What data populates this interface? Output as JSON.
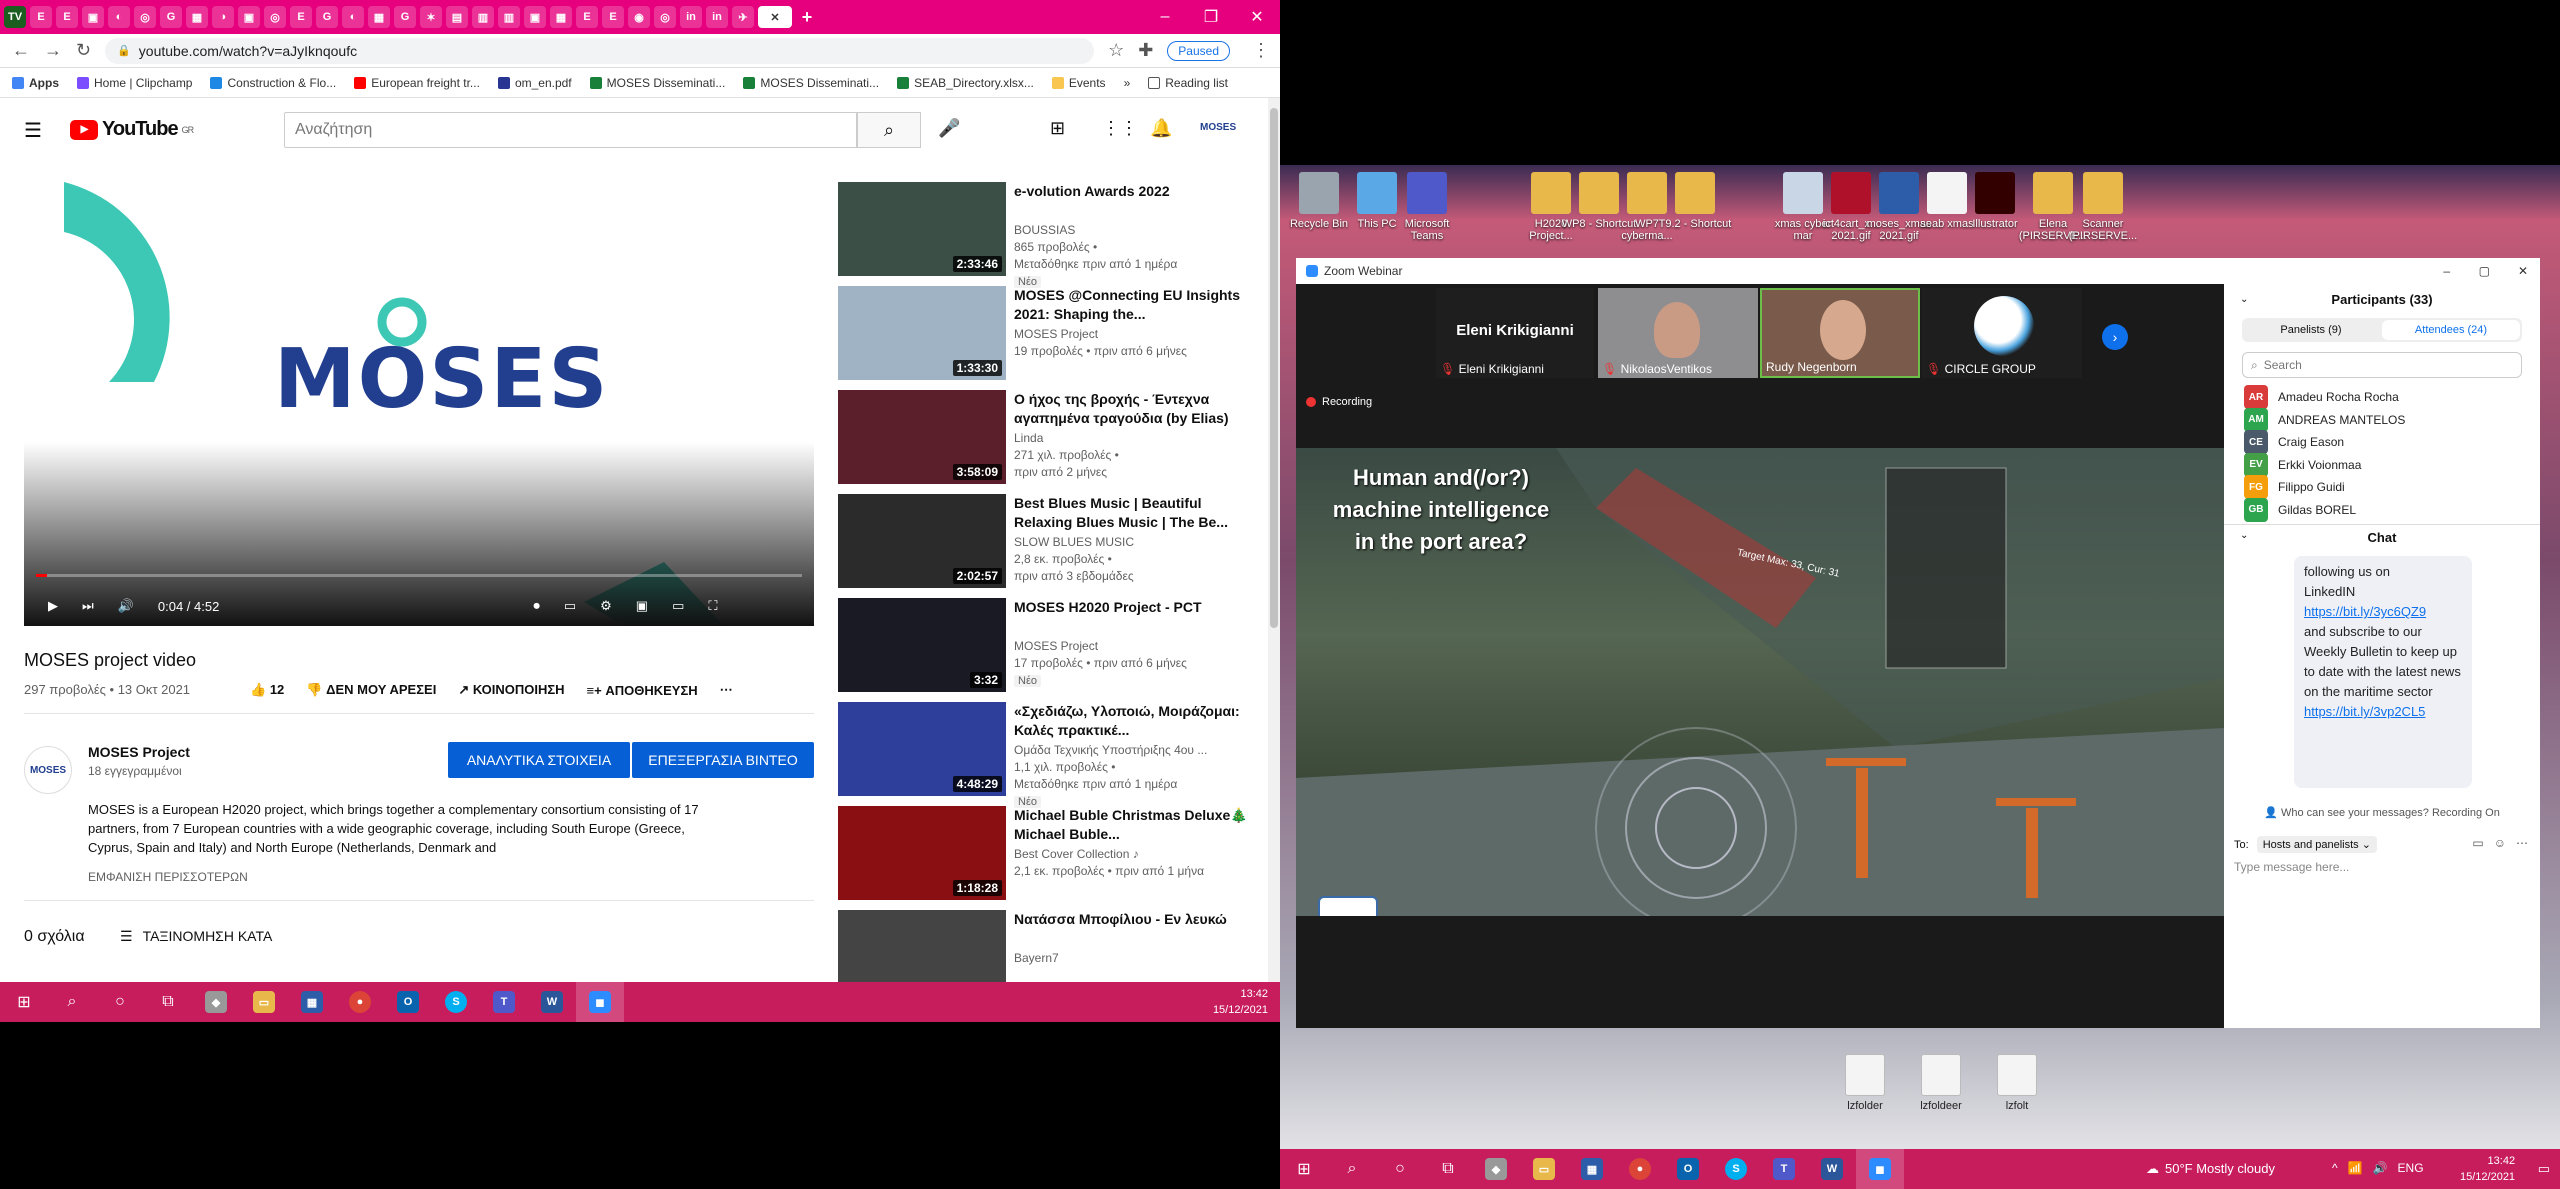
{
  "browser": {
    "url": "youtube.com/watch?v=aJyIknqoufc",
    "paused": "Paused",
    "bookmarks": [
      "Apps",
      "Home | Clipchamp",
      "Construction & Flo...",
      "European freight tr...",
      "om_en.pdf",
      "MOSES Disseminati...",
      "MOSES Disseminati...",
      "SEAB_Directory.xlsx...",
      "Events",
      "Reading list"
    ]
  },
  "youtube": {
    "country": "GR",
    "search_placeholder": "Αναζήτηση",
    "player": {
      "logo_text": "MOSES",
      "time": "0:04 / 4:52",
      "progress": 0.014
    },
    "video_title": "MOSES project video",
    "views_date": "297 προβολές • 13 Οκτ 2021",
    "likes": "12",
    "dislike": "ΔΕΝ ΜΟΥ ΑΡΕΣΕΙ",
    "share": "ΚΟΙΝΟΠΟΙΗΣΗ",
    "save": "ΑΠΟΘΗΚΕΥΣΗ",
    "channel": {
      "name": "MOSES Project",
      "subs": "18 εγγεγραμμένοι",
      "avatar": "MOSES"
    },
    "btn_analytics": "ΑΝΑΛΥΤΙΚΑ ΣΤΟΙΧΕΙΑ",
    "btn_edit": "ΕΠΕΞΕΡΓΑΣΙΑ ΒΙΝΤΕΟ",
    "description": "MOSES is a European H2020 project, which brings together a complementary consortium consisting of 17 partners, from 7 European countries with a wide geographic coverage, including South Europe (Greece, Cyprus, Spain and Italy) and North Europe (Netherlands, Denmark and",
    "show_more": "ΕΜΦΑΝΙΣΗ ΠΕΡΙΣΣΟΤΕΡΩΝ",
    "comments": "0 σχόλια",
    "sort": "ΤΑΞΙΝΟΜΗΣΗ ΚΑΤΑ",
    "related": [
      {
        "title": "e-volution Awards 2022",
        "channel": "BOUSSIAS",
        "meta1": "865 προβολές •",
        "meta2": "Μεταδόθηκε πριν από 1 ημέρα",
        "badge": "Νέο",
        "dur": "2:33:46",
        "color": "#3b4f47"
      },
      {
        "title": "MOSES @Connecting EU Insights 2021: Shaping the...",
        "channel": "MOSES Project",
        "meta1": "19 προβολές • πριν από 6 μήνες",
        "meta2": "",
        "badge": "",
        "dur": "1:33:30",
        "color": "#9fb3c4"
      },
      {
        "title": "Ο ήχος της βροχής - Έντεχνα αγαπημένα τραγούδια (by Elias)",
        "channel": "Linda",
        "meta1": "271 χιλ. προβολές •",
        "meta2": "πριν από 2 μήνες",
        "badge": "",
        "dur": "3:58:09",
        "color": "#5a1f2a"
      },
      {
        "title": "Best Blues Music | Beautiful Relaxing Blues Music | The Be...",
        "channel": "SLOW BLUES MUSIC",
        "meta1": "2,8 εκ. προβολές •",
        "meta2": "πριν από 3 εβδομάδες",
        "badge": "",
        "dur": "2:02:57",
        "color": "#2b2b2b"
      },
      {
        "title": "MOSES H2020 Project - PCT",
        "channel": "MOSES Project",
        "meta1": "17 προβολές • πριν από 6 μήνες",
        "meta2": "",
        "badge": "Νέο",
        "dur": "3:32",
        "color": "#1a1a24"
      },
      {
        "title": "«Σχεδιάζω, Υλοποιώ, Μοιράζομαι: Καλές πρακτικέ...",
        "channel": "Ομάδα Τεχνικής Υποστήριξης 4ου ...",
        "meta1": "1,1 χιλ. προβολές •",
        "meta2": "Μεταδόθηκε πριν από 1 ημέρα",
        "badge": "Νέο",
        "dur": "4:48:29",
        "color": "#2d3f9a"
      },
      {
        "title": "Michael Buble Christmas Deluxe🎄Michael Buble...",
        "channel": "Best Cover Collection ♪",
        "meta1": "2,1 εκ. προβολές • πριν από 1 μήνα",
        "meta2": "",
        "badge": "",
        "dur": "1:18:28",
        "color": "#8a0f12"
      },
      {
        "title": "Νατάσσα Μποφίλιου - Εν λευκώ",
        "channel": "Bayern7",
        "meta1": "",
        "meta2": "",
        "badge": "",
        "dur": "",
        "color": "#444"
      }
    ]
  },
  "taskbar_left": {
    "time": "13:42",
    "date": "15/12/2021"
  },
  "desktop_icons": [
    {
      "label": "Recycle Bin",
      "color": "#9aa4ae"
    },
    {
      "label": "This PC",
      "color": "#5aa9e6"
    },
    {
      "label": "Microsoft Teams",
      "color": "#5059c9"
    },
    {
      "label": "H2020 Project...",
      "color": "#e8b84a"
    },
    {
      "label": "WP8 - Shortcut",
      "color": "#e8b84a"
    },
    {
      "label": "WP7 cyberma...",
      "color": "#e8b84a"
    },
    {
      "label": "T9.2 - Shortcut",
      "color": "#e8b84a"
    },
    {
      "label": "xmas cyber mar",
      "color": "#c9d6e6"
    },
    {
      "label": "ict4cart_x... 2021.gif",
      "color": "#b0112a"
    },
    {
      "label": "moses_xmas 2021.gif",
      "color": "#2d5ca8"
    },
    {
      "label": "seab xmas",
      "color": "#f4f4f4"
    },
    {
      "label": "Illustrator",
      "color": "#330000"
    },
    {
      "label": "Elena (PIRSERVE...",
      "color": "#e8b84a"
    },
    {
      "label": "Scanner (PIRSERVE...",
      "color": "#e8b84a"
    }
  ],
  "bottom_icons": [
    "lzfolder",
    "lzfoldeer",
    "lzfolt"
  ],
  "zoom": {
    "title": "Zoom Webinar",
    "recording": "Recording",
    "speaker": "Eleni Krikigianni",
    "videos": [
      "Eleni Krikigianni",
      "NikolaosVentikos",
      "Rudy Negenborn",
      "CIRCLE GROUP"
    ],
    "overlay_text": [
      "Human and(/or?)",
      "machine intelligence",
      "in the port area?"
    ],
    "port_label": "Target Max: 33, Cur: 31",
    "participants_title": "Participants (33)",
    "tab_panelists": "Panelists (9)",
    "tab_attendees": "Attendees (24)",
    "search": "Search",
    "people": [
      {
        "name": "Amadeu Rocha Rocha",
        "init": "AR",
        "color": "#d93b3b"
      },
      {
        "name": "ANDREAS MANTELOS",
        "init": "AM",
        "color": "#2da44e"
      },
      {
        "name": "Craig Eason",
        "init": "CE",
        "color": "#4a5a6a"
      },
      {
        "name": "Erkki Voionmaa",
        "init": "EV",
        "color": "#43a047"
      },
      {
        "name": "Filippo Guidi",
        "init": "FG",
        "color": "#f59e0b"
      },
      {
        "name": "Gildas BOREL",
        "init": "GB",
        "color": "#2da44e"
      }
    ],
    "chat_title": "Chat",
    "chat_lines": [
      "following us on",
      "LinkedIN"
    ],
    "chat_link1": "https://bit.ly/3yc6QZ9",
    "chat_mid": "and subscribe to our Weekly Bulletin to keep up to date with the latest news on the maritime sector",
    "chat_link2": "https://bit.ly/3vp2CL5",
    "who_can_see": "Who can see your messages? Recording On",
    "to_label": "To:",
    "to_value": "Hosts and panelists",
    "type_placeholder": "Type message here..."
  },
  "taskbar_right": {
    "weather": "50°F Mostly cloudy",
    "lang": "ENG",
    "time": "13:42",
    "date": "15/12/2021"
  }
}
